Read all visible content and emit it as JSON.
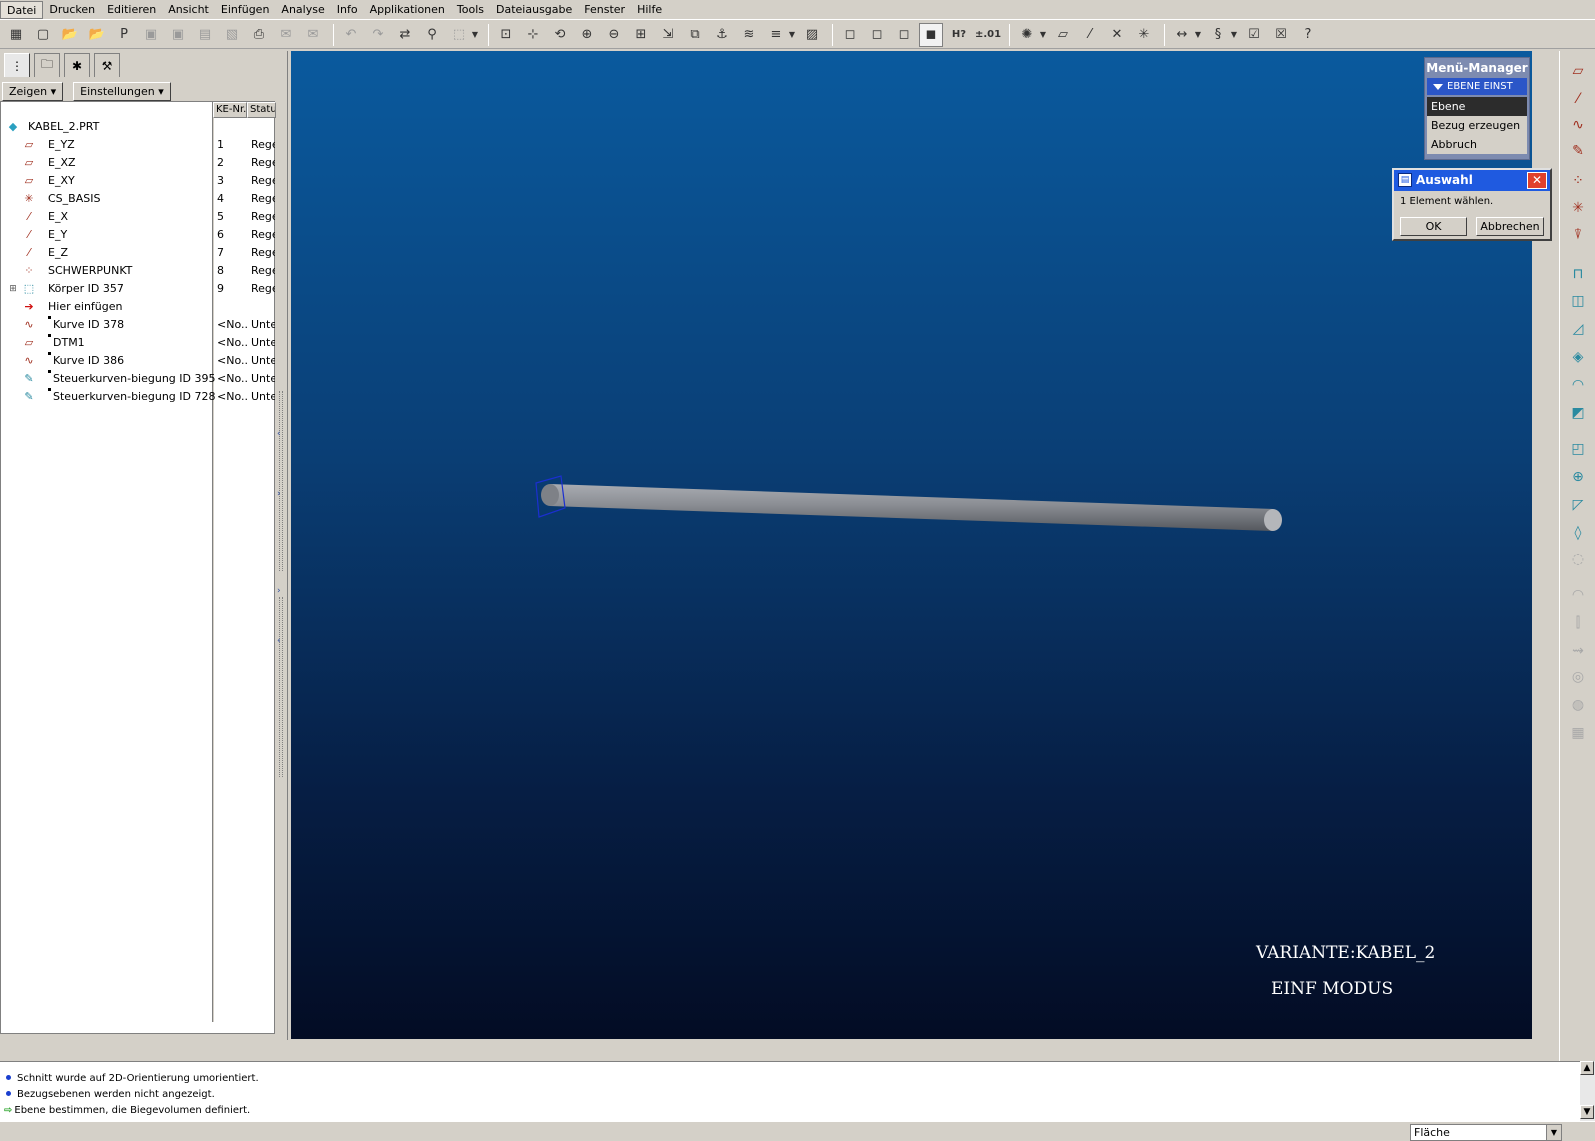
{
  "menubar": {
    "items": [
      "Datei",
      "Drucken",
      "Editieren",
      "Ansicht",
      "Einfügen",
      "Analyse",
      "Info",
      "Applikationen",
      "Tools",
      "Dateiausgabe",
      "Fenster",
      "Hilfe"
    ]
  },
  "toolbar": {
    "hidden_label": "H?",
    "precision_label": "±.01"
  },
  "panel": {
    "btn_show": "Zeigen",
    "btn_settings": "Einstellungen",
    "col_ke": "KE-Nr.",
    "col_status": "Status"
  },
  "tree": {
    "root": "KABEL_2.PRT",
    "items": [
      {
        "label": "E_YZ",
        "num": "1",
        "status": "Regeneriert"
      },
      {
        "label": "E_XZ",
        "num": "2",
        "status": "Regeneriert"
      },
      {
        "label": "E_XY",
        "num": "3",
        "status": "Regeneriert"
      },
      {
        "label": "CS_BASIS",
        "num": "4",
        "status": "Regeneriert"
      },
      {
        "label": "E_X",
        "num": "5",
        "status": "Regeneriert"
      },
      {
        "label": "E_Y",
        "num": "6",
        "status": "Regeneriert"
      },
      {
        "label": "E_Z",
        "num": "7",
        "status": "Regeneriert"
      },
      {
        "label": "SCHWERPUNKT",
        "num": "8",
        "status": "Regeneriert"
      },
      {
        "label": "Körper ID 357",
        "num": "9",
        "status": "Regeneriert"
      },
      {
        "label": "Hier einfügen",
        "num": "",
        "status": ""
      },
      {
        "label": "Kurve ID 378",
        "num": "<No...",
        "status": "Unterdrückt"
      },
      {
        "label": "DTM1",
        "num": "<No...",
        "status": "Unterdrückt"
      },
      {
        "label": "Kurve ID 386",
        "num": "<No...",
        "status": "Unterdrückt"
      },
      {
        "label": "Steuerkurven-biegung ID 395",
        "num": "<No...",
        "status": "Unterdrückt"
      },
      {
        "label": "Steuerkurven-biegung ID 728",
        "num": "<No...",
        "status": "Unterdrückt"
      }
    ]
  },
  "viewport": {
    "variant": "VARIANTE:KABEL_2",
    "mode": "EINF MODUS",
    "background_top": "#0a5a9e",
    "background_bottom": "#030c24"
  },
  "menu_manager": {
    "title": "Menü-Manager",
    "submenu": "EBENE EINST",
    "items": [
      "Ebene",
      "Bezug erzeugen",
      "Abbruch"
    ]
  },
  "auswahl": {
    "title": "Auswahl",
    "message": "1 Element wählen.",
    "ok": "OK",
    "cancel": "Abbrechen"
  },
  "messages": [
    "Schnitt wurde auf 2D-Orientierung umorientiert.",
    "Bezugsebenen werden nicht angezeigt.",
    "Ebene bestimmen, die Biegevolumen definiert."
  ],
  "statusbar": {
    "filter": "Fläche"
  }
}
